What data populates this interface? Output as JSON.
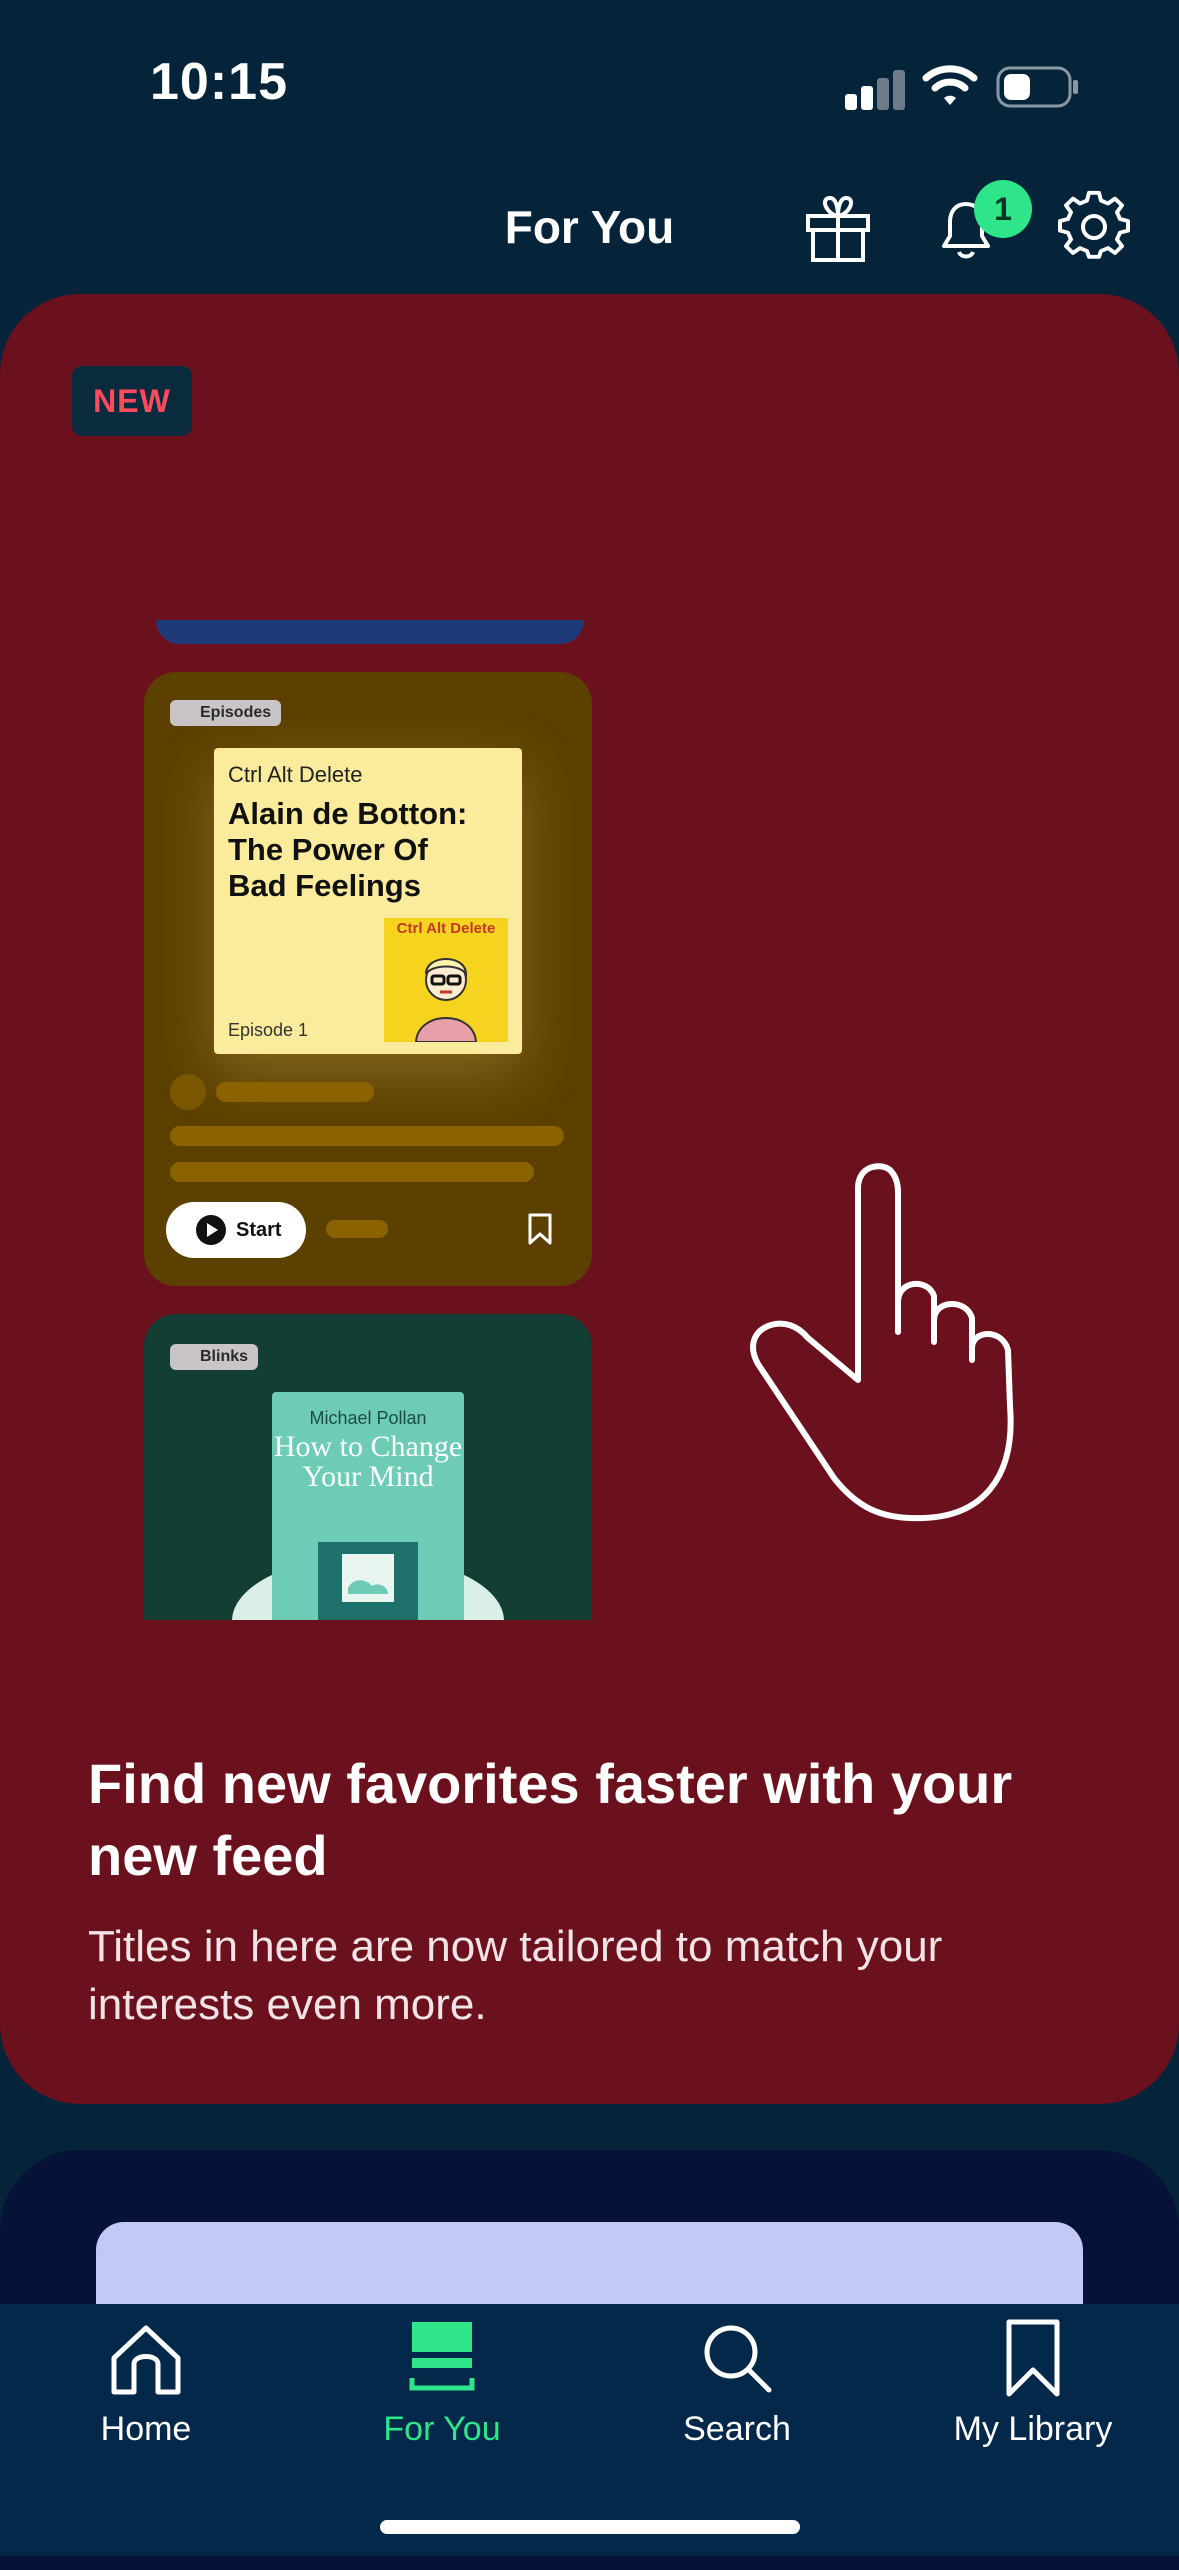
{
  "status_bar": {
    "time": "10:15"
  },
  "header": {
    "title": "For You",
    "notification_count": "1"
  },
  "promo": {
    "badge": "NEW",
    "cards": [
      {
        "tag": "Episodes",
        "subtitle": "Ctrl Alt Delete",
        "title": "Alain de Botton: The Power Of Bad Feelings",
        "episode": "Episode 1",
        "art_text": "Ctrl Alt Delete",
        "start_label": "Start"
      },
      {
        "tag": "Blinks",
        "author": "Michael Pollan",
        "title": "How to Change Your Mind"
      }
    ],
    "title": "Find new favorites faster with your new feed",
    "subtitle": "Titles in here are now tailored to match your interests even more."
  },
  "tabs": [
    {
      "label": "Home",
      "icon": "home-icon",
      "active": false
    },
    {
      "label": "For You",
      "icon": "for-you-icon",
      "active": true
    },
    {
      "label": "Search",
      "icon": "search-icon",
      "active": false
    },
    {
      "label": "My Library",
      "icon": "bookmark-icon",
      "active": false
    }
  ],
  "colors": {
    "background": "#05243a",
    "promo_card": "#6b111d",
    "accent_green": "#2ee58a",
    "badge_red": "#ff4b5c"
  }
}
